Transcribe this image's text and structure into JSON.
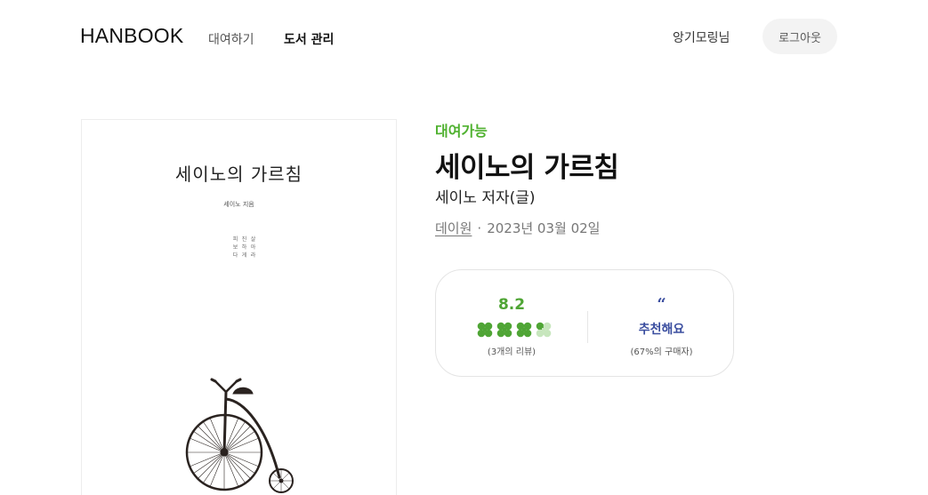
{
  "header": {
    "logo": "HANBOOK",
    "nav": {
      "rent": "대여하기",
      "manage": "도서 관리"
    },
    "user_name": "앙기모링님",
    "logout_label": "로그아웃"
  },
  "cover": {
    "title": "세이노의 가르침",
    "author": "세이노 지음",
    "vertical_text": [
      "피보다",
      "진하게",
      "살아라"
    ],
    "illustration": "penny-farthing-bicycle"
  },
  "book": {
    "status": "대여가능",
    "title": "세이노의 가르침",
    "author": "세이노 저자(글)",
    "publisher": "데이원",
    "separator": "·",
    "pub_date": "2023년 03월 02일"
  },
  "rating": {
    "score": "8.2",
    "clovers": {
      "total": 4,
      "filled": 3,
      "partial": 0.2
    },
    "review_count": "(3개의 리뷰)",
    "quote_icon": "“",
    "recommend_label": "추천해요",
    "recommend_pct": "(67%의 구매자)"
  },
  "colors": {
    "status_green": "#4fb12f",
    "clover_green": "#4fa535",
    "clover_empty": "#c7e6bd",
    "recommend_blue": "#3c4fa0"
  }
}
